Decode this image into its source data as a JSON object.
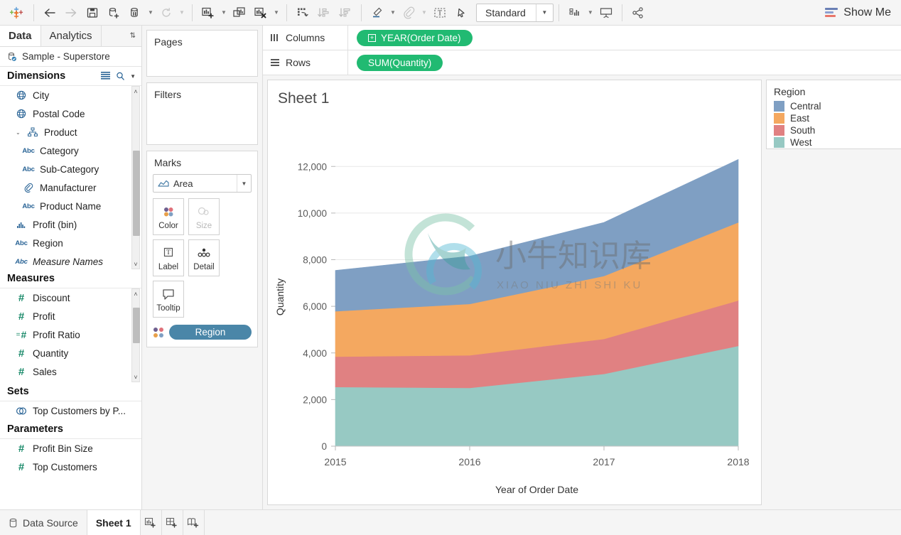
{
  "toolbar": {
    "buttons": [
      {
        "name": "tableau-logo-icon",
        "label": ""
      },
      {
        "name": "back-icon",
        "label": ""
      },
      {
        "name": "forward-icon",
        "label": ""
      },
      {
        "name": "save-icon",
        "label": ""
      },
      {
        "name": "new-data-source-icon",
        "label": ""
      },
      {
        "name": "pause-data-source-icon",
        "label": ""
      },
      {
        "name": "refresh-data-source-icon",
        "label": ""
      },
      {
        "name": "new-worksheet-icon",
        "label": ""
      },
      {
        "name": "duplicate-sheet-icon",
        "label": ""
      },
      {
        "name": "clear-sheet-icon",
        "label": ""
      },
      {
        "name": "swap-rows-columns-icon",
        "label": ""
      },
      {
        "name": "sort-ascending-icon",
        "label": ""
      },
      {
        "name": "sort-descending-icon",
        "label": ""
      },
      {
        "name": "highlight-icon",
        "label": ""
      },
      {
        "name": "group-members-icon",
        "label": ""
      },
      {
        "name": "show-mark-labels-icon",
        "label": ""
      },
      {
        "name": "fix-axes-icon",
        "label": ""
      },
      {
        "name": "presentation-mode-icon",
        "label": ""
      },
      {
        "name": "share-workbook-icon",
        "label": ""
      }
    ],
    "fit": {
      "value": "Standard"
    },
    "show_me": "Show Me"
  },
  "data_pane": {
    "tabs": [
      {
        "label": "Data",
        "active": true
      },
      {
        "label": "Analytics",
        "active": false
      }
    ],
    "data_source": "Sample - Superstore",
    "sections": [
      {
        "title": "Dimensions",
        "fields": [
          {
            "label": "City",
            "icon": "globe-icon",
            "indent": 1
          },
          {
            "label": "Postal Code",
            "icon": "globe-icon",
            "indent": 1
          },
          {
            "label": "Product",
            "icon": "hierarchy-icon",
            "indent": 0,
            "expanded": true
          },
          {
            "label": "Category",
            "icon": "abc-icon",
            "indent": 2
          },
          {
            "label": "Sub-Category",
            "icon": "abc-icon",
            "indent": 2
          },
          {
            "label": "Manufacturer",
            "icon": "paperclip-icon",
            "indent": 2
          },
          {
            "label": "Product Name",
            "icon": "abc-icon",
            "indent": 2
          },
          {
            "label": "Profit (bin)",
            "icon": "bin-icon",
            "indent": 1
          },
          {
            "label": "Region",
            "icon": "abc-icon",
            "indent": 1
          },
          {
            "label": "Measure Names",
            "icon": "abc-icon",
            "indent": 1,
            "italic": true
          }
        ]
      },
      {
        "title": "Measures",
        "fields": [
          {
            "label": "Discount",
            "icon": "number-icon",
            "indent": 1
          },
          {
            "label": "Profit",
            "icon": "number-icon",
            "indent": 1
          },
          {
            "label": "Profit Ratio",
            "icon": "calculated-number-icon",
            "indent": 1
          },
          {
            "label": "Quantity",
            "icon": "number-icon",
            "indent": 1
          },
          {
            "label": "Sales",
            "icon": "number-icon",
            "indent": 1
          }
        ]
      },
      {
        "title": "Sets",
        "fields": [
          {
            "label": "Top Customers by P...",
            "icon": "set-icon",
            "indent": 1
          }
        ]
      },
      {
        "title": "Parameters",
        "fields": [
          {
            "label": "Profit Bin Size",
            "icon": "number-icon",
            "indent": 1
          },
          {
            "label": "Top Customers",
            "icon": "number-icon",
            "indent": 1
          }
        ]
      }
    ]
  },
  "cards": {
    "pages": {
      "title": "Pages"
    },
    "filters": {
      "title": "Filters"
    },
    "marks": {
      "title": "Marks",
      "mark_type": "Area",
      "buttons": [
        {
          "label": "Color",
          "icon": "color-dots-icon",
          "disabled": false
        },
        {
          "label": "Size",
          "icon": "size-circles-icon",
          "disabled": true
        },
        {
          "label": "Label",
          "icon": "label-text-icon",
          "disabled": false
        },
        {
          "label": "Detail",
          "icon": "detail-dots-icon",
          "disabled": false
        },
        {
          "label": "Tooltip",
          "icon": "tooltip-bubble-icon",
          "disabled": false
        }
      ],
      "pills": [
        {
          "label": "Region",
          "icon": "color-dots-icon"
        }
      ]
    }
  },
  "shelves": {
    "columns": {
      "label": "Columns",
      "pill": "YEAR(Order Date)"
    },
    "rows": {
      "label": "Rows",
      "pill": "SUM(Quantity)"
    }
  },
  "view": {
    "sheet_title": "Sheet 1",
    "watermark_text": "小牛知识库",
    "watermark_sub": "XIAO NIU ZHI SHI KU"
  },
  "legend": {
    "title": "Region",
    "items": [
      {
        "label": "Central",
        "color": "#7f9fc3"
      },
      {
        "label": "East",
        "color": "#f4a860"
      },
      {
        "label": "South",
        "color": "#e08182"
      },
      {
        "label": "West",
        "color": "#97c9c3"
      }
    ]
  },
  "status_bar": {
    "data_source_tab": "Data Source",
    "sheet_tab": "Sheet 1",
    "new_sheet_icons": [
      "new-worksheet-icon",
      "new-dashboard-icon",
      "new-story-icon"
    ]
  },
  "chart_data": {
    "type": "area",
    "title": "Sheet 1",
    "xlabel": "Year of Order Date",
    "ylabel": "Quantity",
    "categories": [
      "2015",
      "2016",
      "2017",
      "2018"
    ],
    "ylim": [
      0,
      12800
    ],
    "yticks": [
      0,
      2000,
      4000,
      6000,
      8000,
      10000,
      12000
    ],
    "ytick_labels": [
      "0",
      "2,000",
      "4,000",
      "6,000",
      "8,000",
      "10,000",
      "12,000"
    ],
    "grid": true,
    "stacked": true,
    "legend_position": "right",
    "series": [
      {
        "name": "West",
        "color": "#97c9c3",
        "values": [
          2540,
          2500,
          3100,
          4300
        ]
      },
      {
        "name": "South",
        "color": "#e08182",
        "values": [
          1300,
          1400,
          1500,
          1950
        ]
      },
      {
        "name": "East",
        "color": "#f4a860",
        "values": [
          1950,
          2200,
          2700,
          3350
        ]
      },
      {
        "name": "Central",
        "color": "#7f9fc3",
        "values": [
          1750,
          2050,
          2300,
          2700
        ]
      }
    ],
    "stack_totals": [
      7540,
      8150,
      9600,
      12300
    ]
  }
}
